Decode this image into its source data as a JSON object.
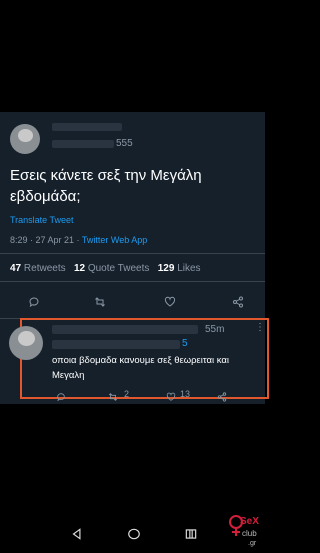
{
  "tweet": {
    "handle_partial": "555",
    "text_line1": "Εσεις κάνετε σεξ την Μεγάλη",
    "text_line2": "εβδομάδα;",
    "translate": "Translate Tweet",
    "time": "8:29 · 27 Apr 21 · ",
    "source": "Twitter Web App",
    "retweets_count": "47",
    "retweets_label": "Retweets",
    "quotes_count": "12",
    "quotes_label": "Quote Tweets",
    "likes_count": "129",
    "likes_label": "Likes"
  },
  "reply": {
    "age": "55m",
    "handle_partial": "5",
    "text_line1": "οποια βδομαδα κανουμε σεξ θεωρειται και",
    "text_line2": "Μεγαλη",
    "retweets": "2",
    "likes": "13"
  },
  "colors": {
    "accent": "#1d9bf0",
    "highlight_border": "#e2582e",
    "background": "#15202b"
  },
  "watermark": {
    "line1": "SeX",
    "line2": "club",
    "line3": ".gr"
  }
}
